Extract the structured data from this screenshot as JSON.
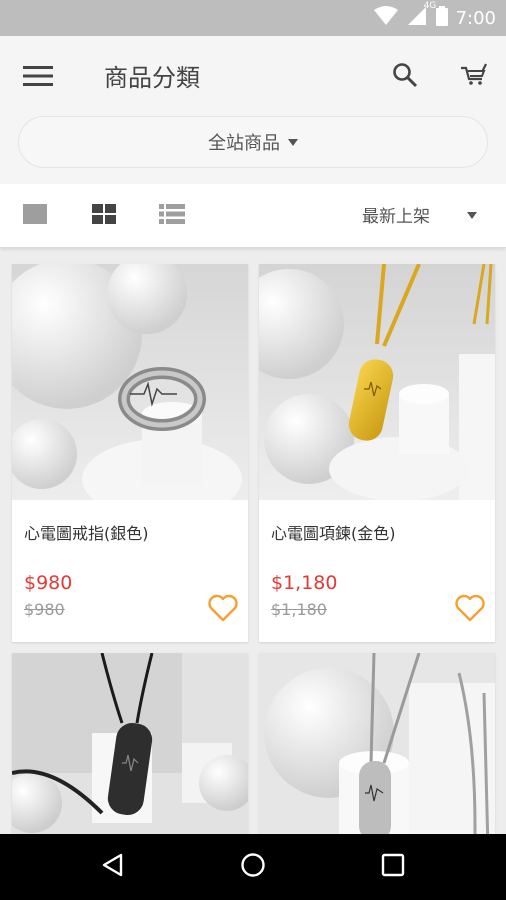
{
  "status_bar": {
    "time": "7:00",
    "network": "4G"
  },
  "app_bar": {
    "title": "商品分類",
    "scope_label": "全站商品",
    "menu_icon": "hamburger-menu-icon",
    "search_icon": "search-icon",
    "cart_icon": "cart-icon"
  },
  "toolbar": {
    "views": [
      "single-column-view-icon",
      "grid-view-icon",
      "list-view-icon"
    ],
    "sort_label": "最新上架"
  },
  "products": [
    {
      "name": "心電圖戒指(銀色)",
      "price": "$980",
      "original_price": "$980",
      "image": "silver ring photo"
    },
    {
      "name": "心電圖項鍊(金色)",
      "price": "$1,180",
      "original_price": "$1,180",
      "image": "gold necklace photo"
    },
    {
      "name": "",
      "price": "",
      "original_price": "",
      "image": "black necklace photo"
    },
    {
      "name": "",
      "price": "",
      "original_price": "",
      "image": "silver necklace photo"
    }
  ],
  "colors": {
    "price_red": "#e53935",
    "favorite_orange": "#f5a033",
    "navbar_black": "#000000",
    "statusbar_gray": "#bdbdbd"
  },
  "navigation_bar": {
    "icons": [
      "back-icon",
      "home-icon",
      "recents-icon"
    ]
  }
}
